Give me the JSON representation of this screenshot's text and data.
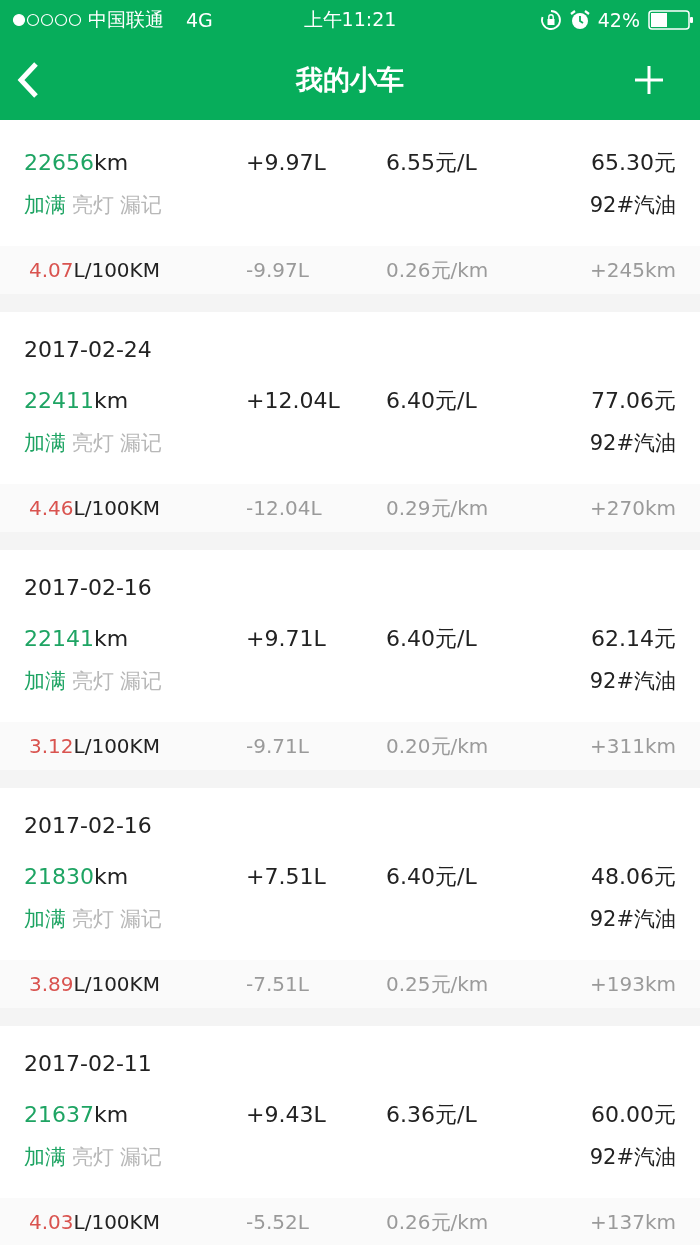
{
  "status_bar": {
    "carrier": "中国联通",
    "network": "4G",
    "time": "上午11:21",
    "battery_text": "42%"
  },
  "nav": {
    "title": "我的小车"
  },
  "records": [
    {
      "odometer": "22656",
      "odometer_unit": "km",
      "fuel_added": "+9.97L",
      "unit_price": "6.55元/L",
      "total": "65.30元",
      "tags": [
        {
          "label": "加满",
          "on": true
        },
        {
          "label": "亮灯",
          "on": false
        },
        {
          "label": "漏记",
          "on": false
        }
      ],
      "fuel_type": "92#汽油",
      "consumption": "4.07",
      "consumption_unit": "L/100KM",
      "fuel_used": "-9.97L",
      "cost_per_km": "0.26元/km",
      "distance": "+245km"
    },
    {
      "date": "2017-02-24",
      "odometer": "22411",
      "odometer_unit": "km",
      "fuel_added": "+12.04L",
      "unit_price": "6.40元/L",
      "total": "77.06元",
      "tags": [
        {
          "label": "加满",
          "on": true
        },
        {
          "label": "亮灯",
          "on": false
        },
        {
          "label": "漏记",
          "on": false
        }
      ],
      "fuel_type": "92#汽油",
      "consumption": "4.46",
      "consumption_unit": "L/100KM",
      "fuel_used": "-12.04L",
      "cost_per_km": "0.29元/km",
      "distance": "+270km"
    },
    {
      "date": "2017-02-16",
      "odometer": "22141",
      "odometer_unit": "km",
      "fuel_added": "+9.71L",
      "unit_price": "6.40元/L",
      "total": "62.14元",
      "tags": [
        {
          "label": "加满",
          "on": true
        },
        {
          "label": "亮灯",
          "on": false
        },
        {
          "label": "漏记",
          "on": false
        }
      ],
      "fuel_type": "92#汽油",
      "consumption": "3.12",
      "consumption_unit": "L/100KM",
      "fuel_used": "-9.71L",
      "cost_per_km": "0.20元/km",
      "distance": "+311km"
    },
    {
      "date": "2017-02-16",
      "odometer": "21830",
      "odometer_unit": "km",
      "fuel_added": "+7.51L",
      "unit_price": "6.40元/L",
      "total": "48.06元",
      "tags": [
        {
          "label": "加满",
          "on": true
        },
        {
          "label": "亮灯",
          "on": false
        },
        {
          "label": "漏记",
          "on": false
        }
      ],
      "fuel_type": "92#汽油",
      "consumption": "3.89",
      "consumption_unit": "L/100KM",
      "fuel_used": "-7.51L",
      "cost_per_km": "0.25元/km",
      "distance": "+193km"
    },
    {
      "date": "2017-02-11",
      "odometer": "21637",
      "odometer_unit": "km",
      "fuel_added": "+9.43L",
      "unit_price": "6.36元/L",
      "total": "60.00元",
      "tags": [
        {
          "label": "加满",
          "on": true
        },
        {
          "label": "亮灯",
          "on": false
        },
        {
          "label": "漏记",
          "on": false
        }
      ],
      "fuel_type": "92#汽油",
      "consumption": "4.03",
      "consumption_unit": "L/100KM",
      "fuel_used": "-5.52L",
      "cost_per_km": "0.26元/km",
      "distance": "+137km"
    }
  ]
}
